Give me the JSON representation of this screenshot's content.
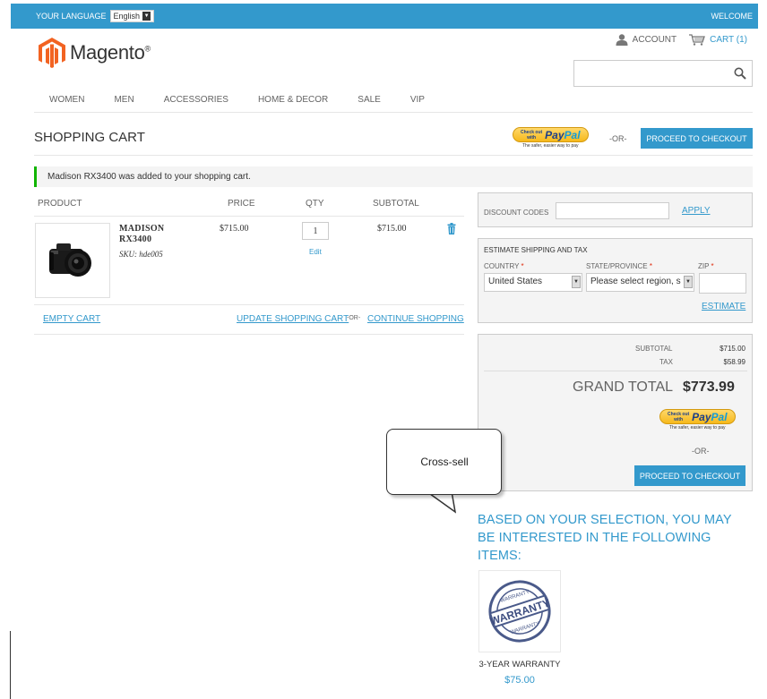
{
  "topbar": {
    "language_label": "YOUR LANGUAGE",
    "language_value": "English",
    "welcome": "WELCOME"
  },
  "logo": {
    "text": "Magento",
    "reg": "®",
    "brand_color": "#f26322"
  },
  "header": {
    "account": "ACCOUNT",
    "cart": "CART (1)",
    "search_placeholder": ""
  },
  "nav": [
    "WOMEN",
    "MEN",
    "ACCESSORIES",
    "HOME & DECOR",
    "SALE",
    "VIP"
  ],
  "page": {
    "title": "SHOPPING CART"
  },
  "paypal": {
    "check_out": "Check out",
    "with": "with",
    "pay": "Pay",
    "pal": "Pal",
    "tagline": "The safer, easier way to pay"
  },
  "checkout": {
    "or": "-OR-",
    "button": "PROCEED TO CHECKOUT"
  },
  "message": {
    "success": "Madison RX3400 was added to your shopping cart.",
    "accent": "#11b400"
  },
  "cart_table": {
    "headers": [
      "PRODUCT",
      "PRICE",
      "QTY",
      "SUBTOTAL"
    ],
    "rows": [
      {
        "name": "MADISON RX3400",
        "sku_label": "SKU:",
        "sku": "hde005",
        "price": "$715.00",
        "qty": "1",
        "edit": "Edit",
        "subtotal": "$715.00"
      }
    ]
  },
  "cart_actions": {
    "empty": "EMPTY CART",
    "update": "UPDATE SHOPPING CART",
    "or": "-OR-",
    "continue": "CONTINUE SHOPPING"
  },
  "discount": {
    "label": "DISCOUNT CODES",
    "value": "",
    "apply": "APPLY"
  },
  "shipping": {
    "title": "ESTIMATE SHIPPING AND TAX",
    "country_label": "COUNTRY",
    "country_value": "United States",
    "state_label": "STATE/PROVINCE",
    "state_value": "Please select region, s",
    "zip_label": "ZIP",
    "zip_value": "",
    "required_mark": "*",
    "estimate": "ESTIMATE"
  },
  "totals": {
    "subtotal_label": "SUBTOTAL",
    "subtotal": "$715.00",
    "tax_label": "TAX",
    "tax": "$58.99",
    "grand_label": "GRAND TOTAL",
    "grand": "$773.99"
  },
  "callout": {
    "text": "Cross-sell"
  },
  "crosssell": {
    "title": "BASED ON YOUR SELECTION, YOU MAY BE INTERESTED IN THE FOLLOWING ITEMS:",
    "items": [
      {
        "name": "3-YEAR WARRANTY",
        "price": "$75.00",
        "badge_text": "WARRANTY",
        "badge_ring": "WARRANTY"
      }
    ]
  },
  "colors": {
    "accent": "#3399cc",
    "panel": "#f4f4f4",
    "text": "#636363",
    "required": "#df280a"
  },
  "icons": [
    "chevron-down-icon",
    "account-icon",
    "cart-icon",
    "search-icon",
    "trash-icon"
  ]
}
